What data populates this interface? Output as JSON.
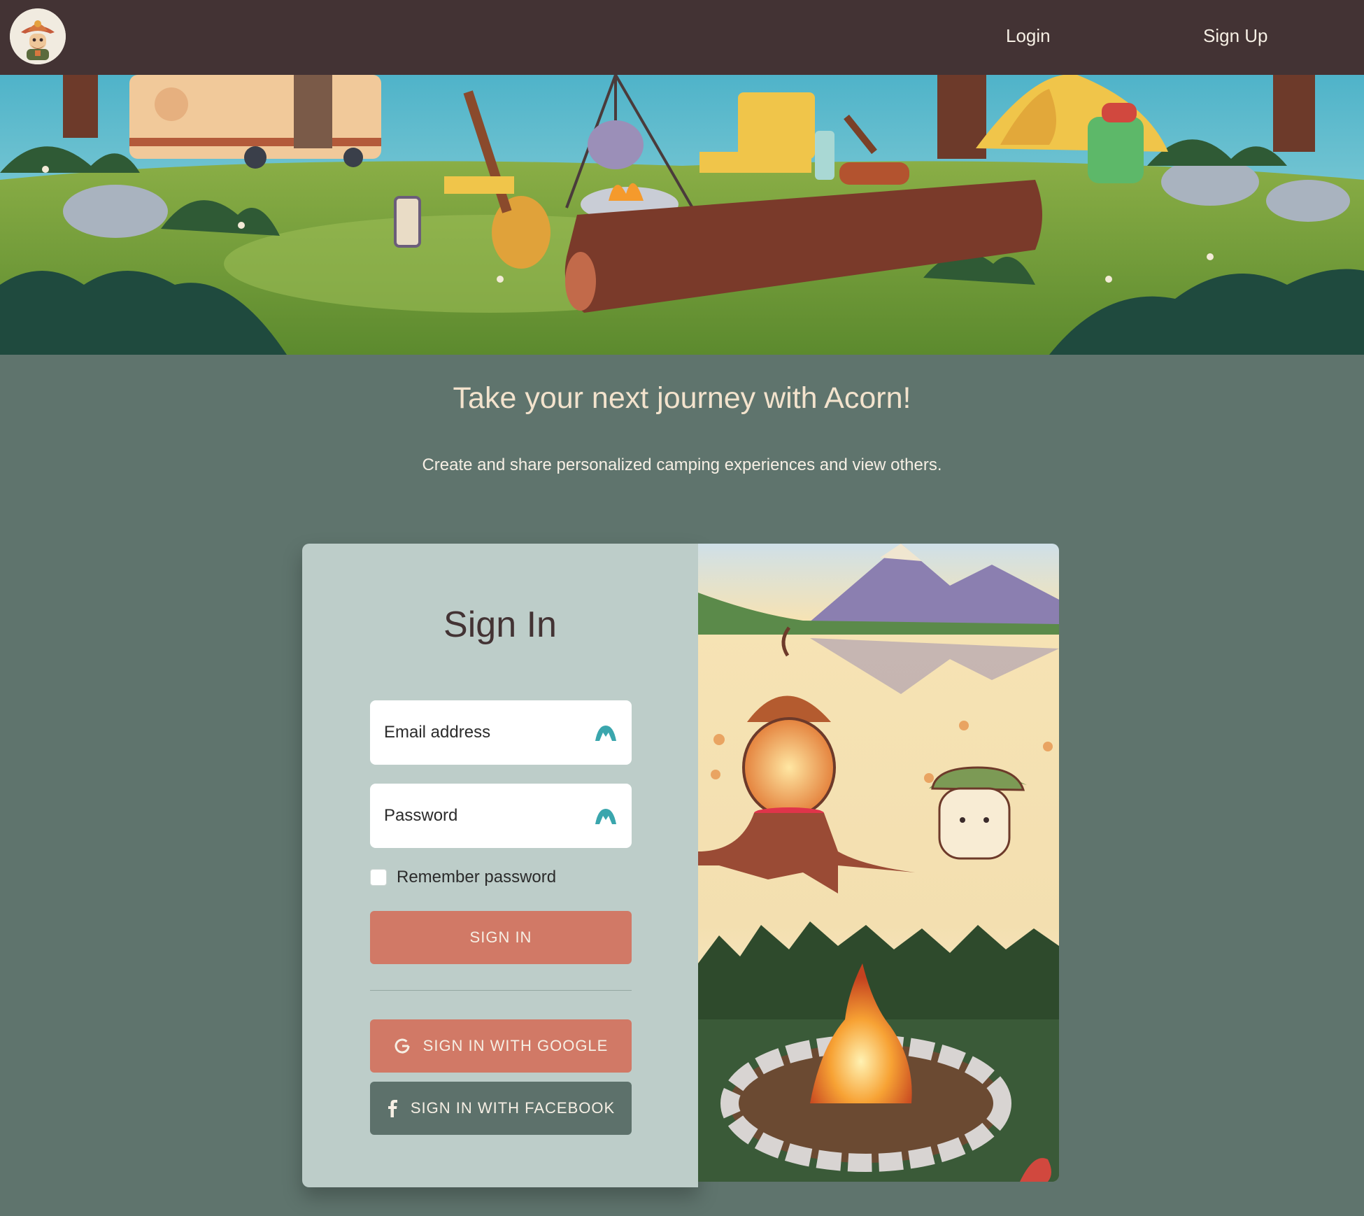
{
  "nav": {
    "login_label": "Login",
    "signup_label": "Sign Up",
    "logo_icon": "ranger-acorn-logo"
  },
  "hero": {
    "headline": "Take your next journey with Acorn!",
    "subline": "Create and share personalized camping experiences and view others."
  },
  "signin": {
    "title": "Sign In",
    "email_placeholder": "Email address",
    "password_placeholder": "Password",
    "remember_label": "Remember password",
    "remember_checked": false,
    "submit_label": "SIGN IN",
    "google_label": "SIGN IN WITH GOOGLE",
    "facebook_label": "SIGN IN WITH FACEBOOK",
    "field_icon": "password-manager-icon"
  },
  "colors": {
    "navbar": "#433334",
    "page_bg": "#5f746d",
    "form_panel": "#bdcdc9",
    "primary_button": "#d17966",
    "facebook_button": "#5d716b",
    "headline_text": "#f3e3cd"
  }
}
